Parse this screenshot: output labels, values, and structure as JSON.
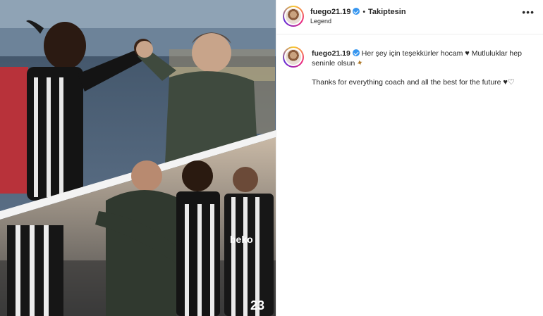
{
  "post": {
    "username": "fuego21.19",
    "follow_label": "Takiptesin",
    "subtitle": "Legend",
    "more_label": "•••",
    "caption_tr_1": "Her şey için teşekkürler hocam",
    "caption_tr_2": "Mutluluklar hep seninle olsun",
    "caption_en": "Thanks for everything coach and all the best for the future",
    "heart_black": "♥",
    "heart_white": "♡",
    "spark_emoji": "✦"
  },
  "photo": {
    "top_scene": "two men high-fiving",
    "bottom_scene": "coach hugging player",
    "jersey_text": "beko",
    "jersey_number": "23"
  }
}
